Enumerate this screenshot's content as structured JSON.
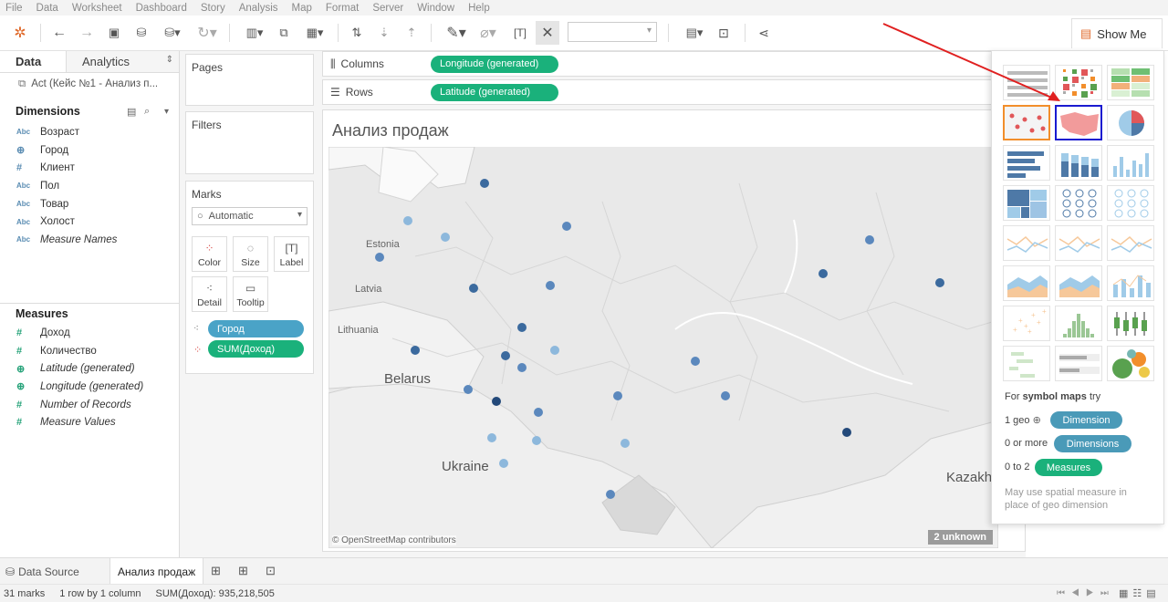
{
  "menu": [
    "File",
    "Data",
    "Worksheet",
    "Dashboard",
    "Story",
    "Analysis",
    "Map",
    "Format",
    "Server",
    "Window",
    "Help"
  ],
  "toolbar": {
    "show_me_label": "Show Me"
  },
  "left_pane": {
    "tab_data": "Data",
    "tab_analytics": "Analytics",
    "datasource": "Act (Кейс №1 - Анализ п...",
    "dimensions_header": "Dimensions",
    "dimensions": [
      {
        "type": "Abc",
        "name": "Возраст"
      },
      {
        "type": "globe",
        "name": "Город"
      },
      {
        "type": "#",
        "name": "Клиент"
      },
      {
        "type": "Abc",
        "name": "Пол"
      },
      {
        "type": "Abc",
        "name": "Товар"
      },
      {
        "type": "Abc",
        "name": "Холост"
      },
      {
        "type": "Abc",
        "name": "Measure Names"
      }
    ],
    "measures_header": "Measures",
    "measures": [
      {
        "type": "#",
        "name": "Доход"
      },
      {
        "type": "#",
        "name": "Количество"
      },
      {
        "type": "globe",
        "name": "Latitude (generated)"
      },
      {
        "type": "globe",
        "name": "Longitude (generated)"
      },
      {
        "type": "#",
        "name": "Number of Records"
      },
      {
        "type": "#",
        "name": "Measure Values"
      }
    ]
  },
  "cards": {
    "pages": "Pages",
    "filters": "Filters",
    "marks": "Marks",
    "mark_type": "Automatic",
    "buttons": [
      "Color",
      "Size",
      "Label",
      "Detail",
      "Tooltip"
    ],
    "pill_city": "Город",
    "pill_sum": "SUM(Доход)"
  },
  "shelves": {
    "columns_label": "Columns",
    "columns_pill": "Longitude (generated)",
    "rows_label": "Rows",
    "rows_pill": "Latitude (generated)"
  },
  "viz": {
    "title": "Анализ продаж",
    "countries": [
      "Estonia",
      "Latvia",
      "Lithuania",
      "Belarus",
      "Ukraine",
      "Kazakh"
    ],
    "attribution": "© OpenStreetMap contributors",
    "unknown_badge": "2 unknown",
    "points": [
      {
        "lon": 29.5,
        "lat": 59.5,
        "level": 3
      },
      {
        "lon": 26.2,
        "lat": 58.2,
        "level": 1
      },
      {
        "lon": 27.8,
        "lat": 57.6,
        "level": 1
      },
      {
        "lon": 33.0,
        "lat": 58.0,
        "level": 2
      },
      {
        "lon": 25.0,
        "lat": 56.9,
        "level": 2
      },
      {
        "lon": 29.0,
        "lat": 55.8,
        "level": 3
      },
      {
        "lon": 32.3,
        "lat": 55.9,
        "level": 2
      },
      {
        "lon": 31.1,
        "lat": 54.4,
        "level": 3
      },
      {
        "lon": 26.5,
        "lat": 53.6,
        "level": 3
      },
      {
        "lon": 30.4,
        "lat": 53.4,
        "level": 3
      },
      {
        "lon": 31.1,
        "lat": 53.0,
        "level": 2
      },
      {
        "lon": 32.5,
        "lat": 53.6,
        "level": 1
      },
      {
        "lon": 28.8,
        "lat": 52.2,
        "level": 2
      },
      {
        "lon": 30.0,
        "lat": 51.8,
        "level": 4
      },
      {
        "lon": 31.8,
        "lat": 51.4,
        "level": 2
      },
      {
        "lon": 29.8,
        "lat": 50.5,
        "level": 1
      },
      {
        "lon": 31.7,
        "lat": 50.4,
        "level": 1
      },
      {
        "lon": 30.3,
        "lat": 49.6,
        "level": 1
      },
      {
        "lon": 35.2,
        "lat": 52.0,
        "level": 2
      },
      {
        "lon": 35.5,
        "lat": 50.3,
        "level": 1
      },
      {
        "lon": 38.5,
        "lat": 53.2,
        "level": 2
      },
      {
        "lon": 39.8,
        "lat": 52.0,
        "level": 2
      },
      {
        "lon": 44.0,
        "lat": 56.3,
        "level": 3
      },
      {
        "lon": 46.0,
        "lat": 57.5,
        "level": 2
      },
      {
        "lon": 49.0,
        "lat": 56.0,
        "level": 3
      },
      {
        "lon": 45.0,
        "lat": 50.7,
        "level": 4
      },
      {
        "lon": 34.9,
        "lat": 48.5,
        "level": 2
      }
    ]
  },
  "show_me": {
    "hint_prefix": "For",
    "hint_bold": "symbol maps",
    "hint_suffix": "try",
    "req1": "1 geo",
    "req1_pill": "Dimension",
    "req2": "0 or more",
    "req2_pill": "Dimensions",
    "req3": "0 to 2",
    "req3_pill": "Measures",
    "note": "May use spatial measure in place of geo dimension"
  },
  "sheet_tabs": {
    "data_source": "Data Source",
    "active": "Анализ продаж"
  },
  "status": {
    "marks": "31 marks",
    "layout": "1 row by 1 column",
    "sum": "SUM(Доход): 935,218,505"
  },
  "colors": {
    "teal_pill": "#1ab17b",
    "blue_pill": "#4aa3c7",
    "dot_levels": [
      "#b9d9f1",
      "#8db8dc",
      "#5b88bd",
      "#3b6a9e",
      "#23497a"
    ]
  }
}
